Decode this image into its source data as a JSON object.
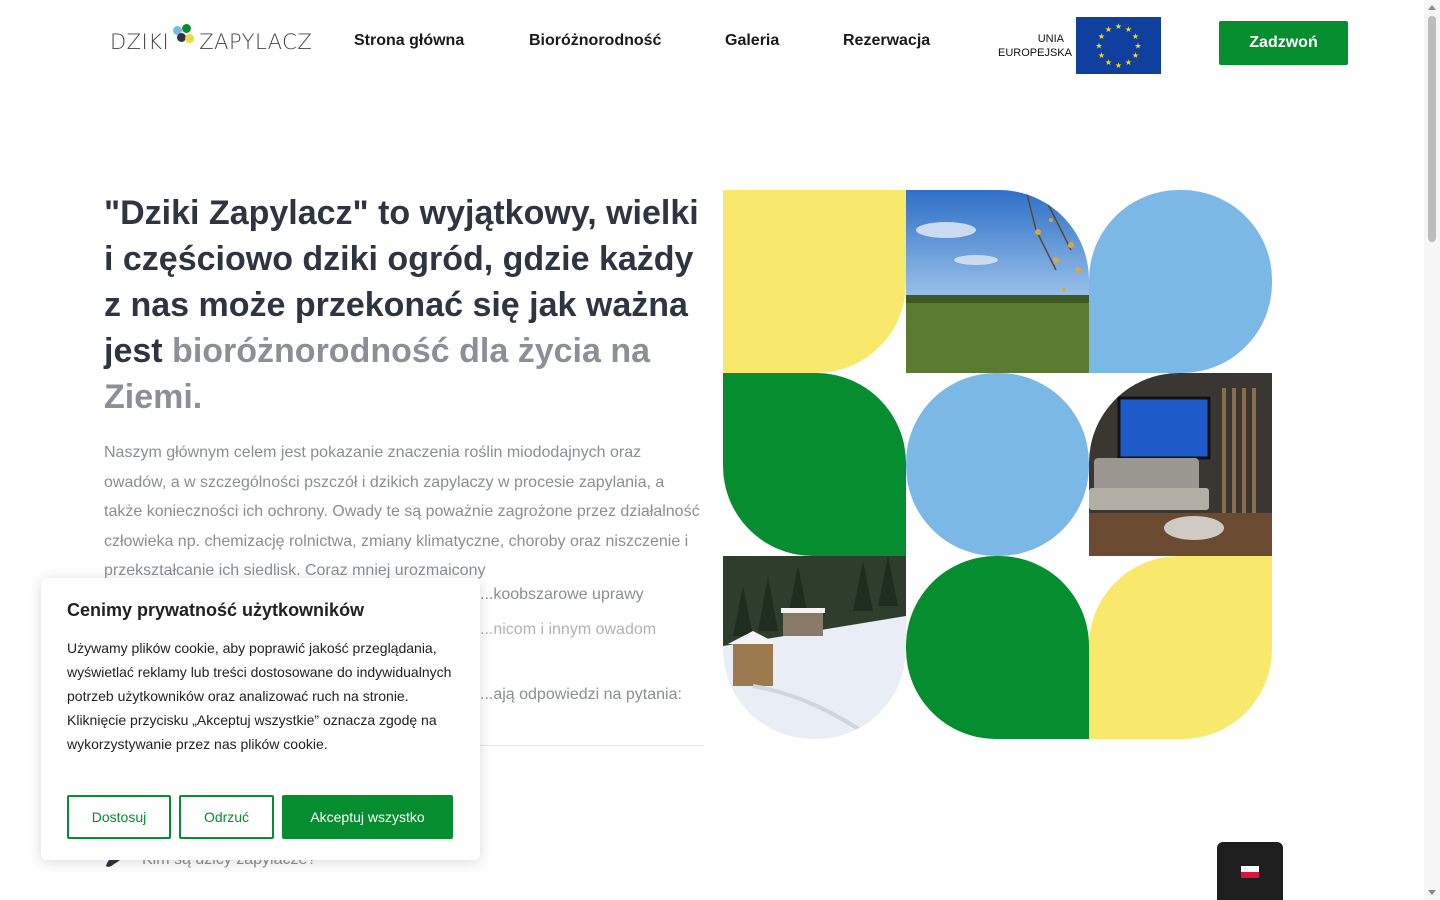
{
  "header": {
    "logo": {
      "part1": "DZIKI",
      "part2": "ZAPYLACZ"
    },
    "nav": [
      "Strona główna",
      "Bioróżnorodność",
      "Galeria",
      "Rezerwacja"
    ],
    "eu": {
      "line1": "UNIA",
      "line2": "EUROPEJSKA"
    },
    "call_label": "Zadzwoń"
  },
  "hero": {
    "title_main": "\"Dziki Zapylacz\" to wyjątkowy, wielki i częściowo dziki ogród, gdzie każdy z nas może przekonać się jak ważna jest",
    "title_fade": "bioróżnorodność dla życia na Ziemi.",
    "body": "Naszym głównym celem jest pokazanie znaczenia roślin miododajnych oraz owadów, a w szczególności pszczół i dzikich zapylaczy w procesie zapylania, a także konieczności ich ochrony. Owady te są poważnie zagrożone przez działalność człowieka np. chemizację rolnictwa, zmiany klimatyczne, choroby oraz niszczenie i przekształcanie ich siedlisk. Coraz mniej urozmaicony",
    "body_tail": "...koobszarowe uprawy",
    "body_tail2": "...nicom i innym owadom",
    "body2": "...ają odpowiedzi na pytania:",
    "faq_item": "Kim są dzicy zapylacze?"
  },
  "colors": {
    "green": "#068d2f",
    "yellow": "#f8e96c",
    "blue": "#7cb8e6",
    "eu_blue": "#0f3f9f"
  },
  "cookie": {
    "title": "Cenimy prywatność użytkowników",
    "text": "Używamy plików cookie, aby poprawić jakość przeglądania, wyświetlać reklamy lub treści dostosowane do indywidualnych potrzeb użytkowników oraz analizować ruch na stronie. Kliknięcie przycisku „Akceptuj wszystkie” oznacza zgodę na wykorzystywanie przez nas plików cookie.",
    "customize": "Dostosuj",
    "reject": "Odrzuć",
    "accept": "Akceptuj wszystko"
  },
  "lang": {
    "current": "Polski"
  }
}
